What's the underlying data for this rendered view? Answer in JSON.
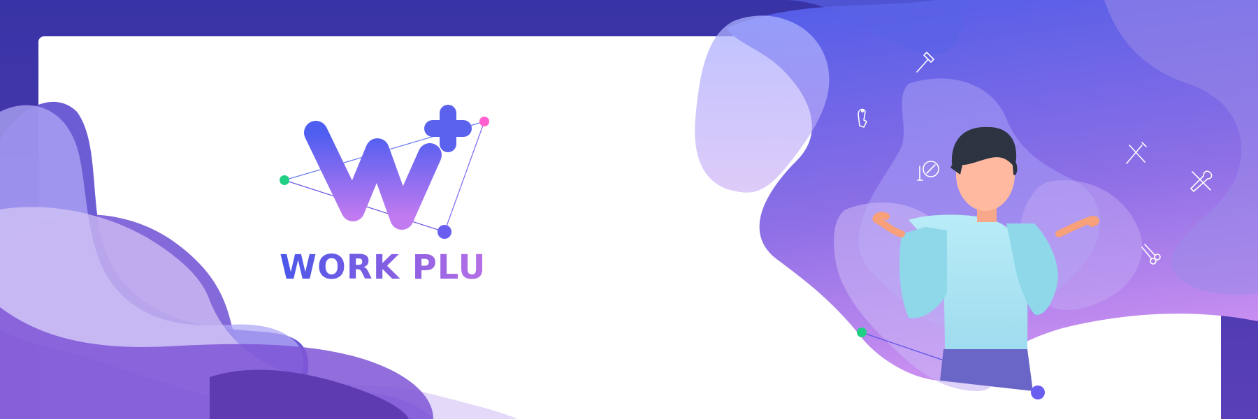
{
  "brand": {
    "name": "WORK PLUS",
    "logo_icon": "w-plus-logo-icon"
  },
  "scene": {
    "person": "shrugging-person-illustration",
    "tool_icons": [
      "hammer-icon",
      "dog-icon",
      "makeup-mirror-icon",
      "knife-fork-icon",
      "wrench-screwdriver-icon",
      "scissors-comb-icon"
    ]
  },
  "colors": {
    "frame": "#3a33a8",
    "card": "#ffffff",
    "accent_blue": "#4a57e8",
    "accent_purple": "#9b5fe0",
    "dot_green": "#1fd084",
    "dot_pink": "#ff5fcf",
    "dot_blue": "#6a5ef0",
    "shirt": "#a8e6f5"
  }
}
